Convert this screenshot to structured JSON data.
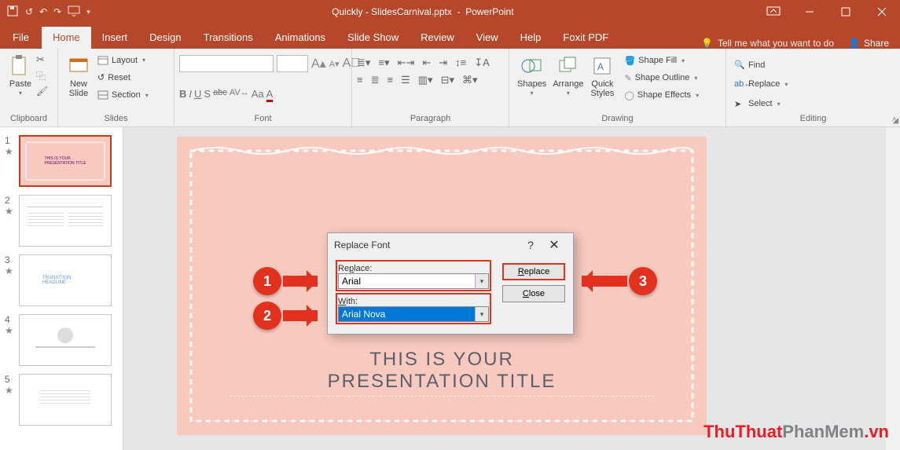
{
  "titlebar": {
    "doc": "Quickly - SlidesCarnival.pptx",
    "app": "PowerPoint"
  },
  "tabs": {
    "file": "File",
    "home": "Home",
    "insert": "Insert",
    "design": "Design",
    "transitions": "Transitions",
    "animations": "Animations",
    "slideshow": "Slide Show",
    "review": "Review",
    "view": "View",
    "help": "Help",
    "foxit": "Foxit PDF",
    "tellme": "Tell me what you want to do",
    "share": "Share"
  },
  "ribbon": {
    "clipboard": {
      "paste": "Paste",
      "label": "Clipboard"
    },
    "slides": {
      "newslide": "New\nSlide",
      "layout": "Layout",
      "reset": "Reset",
      "section": "Section",
      "label": "Slides"
    },
    "font": {
      "label": "Font",
      "bold": "B",
      "italic": "I",
      "underline": "U",
      "shadow": "S",
      "strike": "abc",
      "spacing": "AV",
      "case": "Aa",
      "clear": "A"
    },
    "paragraph": {
      "label": "Paragraph"
    },
    "drawing": {
      "shapes": "Shapes",
      "arrange": "Arrange",
      "quick": "Quick\nStyles",
      "fill": "Shape Fill",
      "outline": "Shape Outline",
      "effects": "Shape Effects",
      "label": "Drawing"
    },
    "editing": {
      "find": "Find",
      "replace": "Replace",
      "select": "Select",
      "label": "Editing"
    }
  },
  "thumbs": [
    "1",
    "2",
    "3",
    "4",
    "5"
  ],
  "slide": {
    "line1": "THIS IS YOUR",
    "line2": "PRESENTATION TITLE"
  },
  "dialog": {
    "title": "Replace Font",
    "replace_label_pre": "Re",
    "replace_label_u": "p",
    "replace_label_post": "lace:",
    "replace_value": "Arial",
    "with_label_u": "W",
    "with_label_post": "ith:",
    "with_value": "Arial Nova",
    "btn_replace_u": "R",
    "btn_replace_post": "eplace",
    "btn_close_u": "C",
    "btn_close_post": "lose"
  },
  "callouts": {
    "c1": "1",
    "c2": "2",
    "c3": "3"
  },
  "watermark": {
    "a": "ThuThuat",
    "b": "PhanMem",
    "c": ".vn"
  }
}
